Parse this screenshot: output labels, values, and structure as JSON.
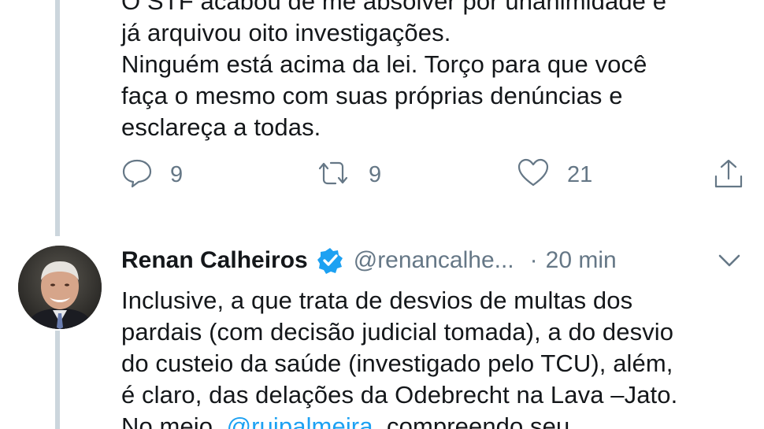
{
  "tweet1": {
    "lines": [
      "O STF acabou de me absolver por unanimidade e",
      "já arquivou oito investigações.",
      "Ninguém está acima da lei. Torço para que você",
      "faça o mesmo com suas próprias denúncias e",
      "esclareça a todas."
    ],
    "actions": {
      "replies": "9",
      "retweets": "9",
      "likes": "21"
    }
  },
  "tweet2": {
    "author_name": "Renan Calheiros",
    "handle": "@renancalhe...",
    "separator": "·",
    "time": "20 min",
    "lines": [
      "Inclusive, a que trata de desvios de multas dos",
      "pardais (com decisão judicial tomada), a do desvio",
      "do custeio da saúde (investigado pelo TCU), além,",
      "é claro, das delações da Odebrecht na Lava –Jato."
    ],
    "partial_line": {
      "before": "No meio, ",
      "mention": "@ruipalmeira",
      "after": ", compreendo seu"
    }
  },
  "icons": [
    "reply-icon",
    "retweet-icon",
    "like-icon",
    "share-icon",
    "verified-badge-icon",
    "chevron-down-icon"
  ],
  "colors": {
    "text": "#14171a",
    "muted": "#657786",
    "link": "#1da1f2",
    "verified": "#1da1f2",
    "thread_line": "#ccd6dd"
  }
}
